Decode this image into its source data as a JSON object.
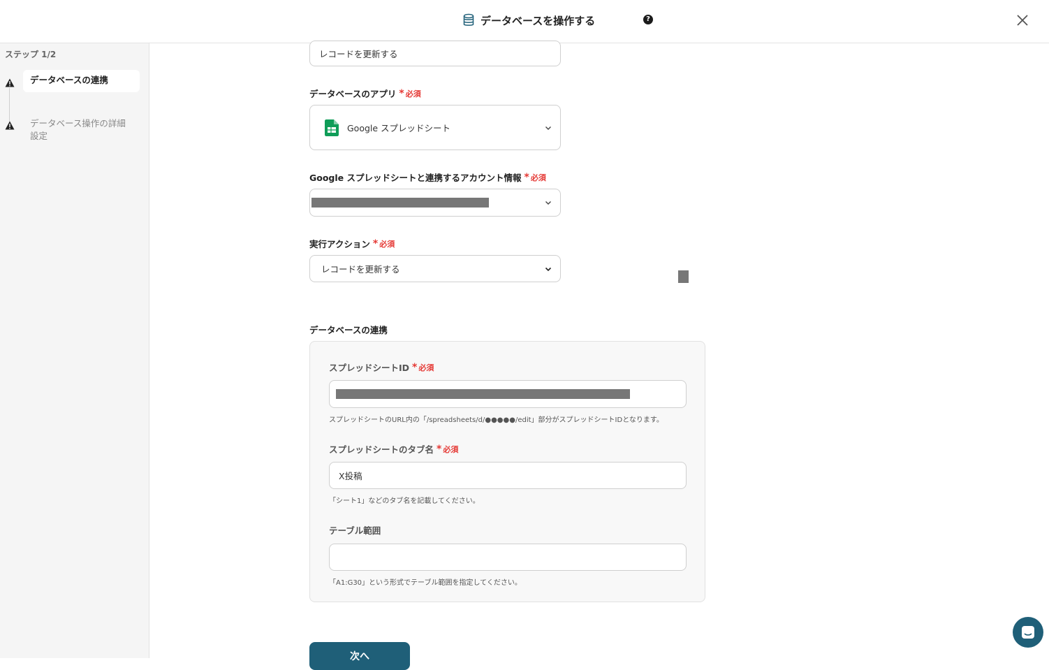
{
  "header": {
    "title": "データベースを操作する",
    "help": "?"
  },
  "sidebar": {
    "step_label": "ステップ 1/2",
    "steps": [
      {
        "label": "データベースの連携",
        "active": true
      },
      {
        "label": "データベース操作の詳細設定",
        "active": false
      }
    ]
  },
  "form": {
    "title_value": "レコードを更新する",
    "app": {
      "label": "データベースのアプリ",
      "required": "必須",
      "value": "Google スプレッドシート"
    },
    "account": {
      "label": "Google スプレッドシートと連携するアカウント情報",
      "required": "必須"
    },
    "action": {
      "label": "実行アクション",
      "required": "必須",
      "value": "レコードを更新する"
    },
    "section_title": "データベースの連携",
    "sheet_id": {
      "label": "スプレッドシートID",
      "required": "必須",
      "help": "スプレッドシートのURL内の「/spreadsheets/d/●●●●●/edit」部分がスプレッドシートIDとなります。"
    },
    "tab_name": {
      "label": "スプレッドシートのタブ名",
      "required": "必須",
      "value": "X投稿",
      "help": "「シート1」などのタブ名を記載してください。"
    },
    "range": {
      "label": "テーブル範囲",
      "value": "",
      "help": "「A1:G30」という形式でテーブル範囲を指定してください。"
    },
    "next_label": "次へ"
  },
  "colors": {
    "accent": "#1f5f78",
    "required": "#e53935",
    "sheets_green": "#0f9d58"
  }
}
